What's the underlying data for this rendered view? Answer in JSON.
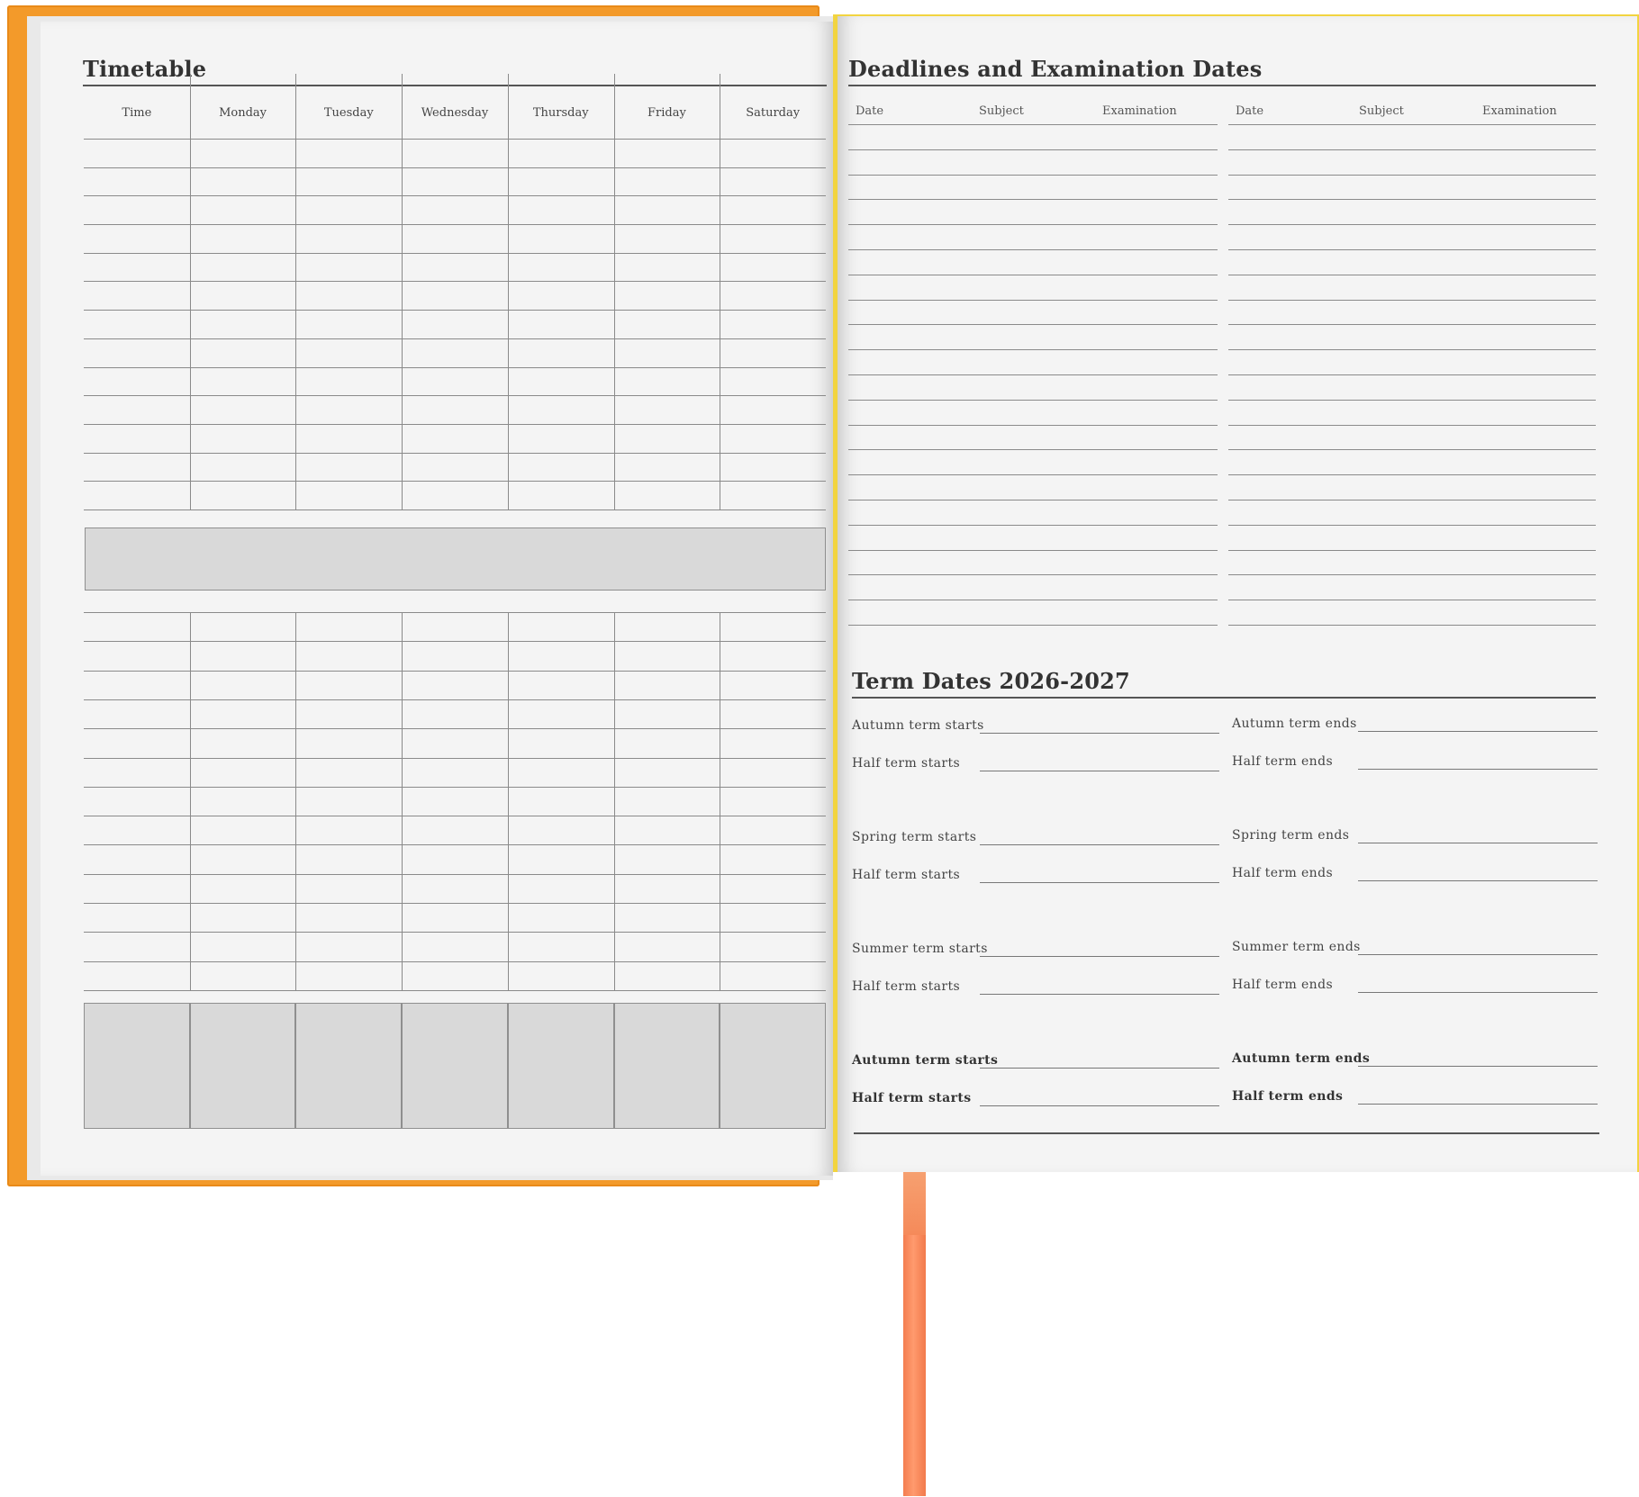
{
  "timetable": {
    "title": "Timetable",
    "columns": [
      "Time",
      "Monday",
      "Tuesday",
      "Wednesday",
      "Thursday",
      "Friday",
      "Saturday"
    ]
  },
  "deadlines": {
    "title": "Deadlines and Examination Dates",
    "columns_left": [
      "Date",
      "Subject",
      "Examination"
    ],
    "columns_right": [
      "Date",
      "Subject",
      "Examination"
    ]
  },
  "term_dates": {
    "title": "Term Dates 2026-2027",
    "rows": [
      {
        "left": "Autumn term starts",
        "right": "Autumn term ends"
      },
      {
        "left": "Half term starts",
        "right": "Half term ends"
      },
      {
        "left": "Spring term starts",
        "right": "Spring term ends"
      },
      {
        "left": "Half term starts",
        "right": "Half term ends"
      },
      {
        "left": "Summer term starts",
        "right": "Summer term ends"
      },
      {
        "left": "Half term starts",
        "right": "Half term ends"
      },
      {
        "left": "Autumn term starts",
        "right": "Autumn term ends"
      },
      {
        "left": "Half term starts",
        "right": "Half term ends"
      }
    ]
  },
  "colors": {
    "cover_orange": "#f39a2a",
    "cover_yellow": "#f2d440",
    "ribbon": "#f58a5a",
    "page": "#f4f4f4"
  }
}
